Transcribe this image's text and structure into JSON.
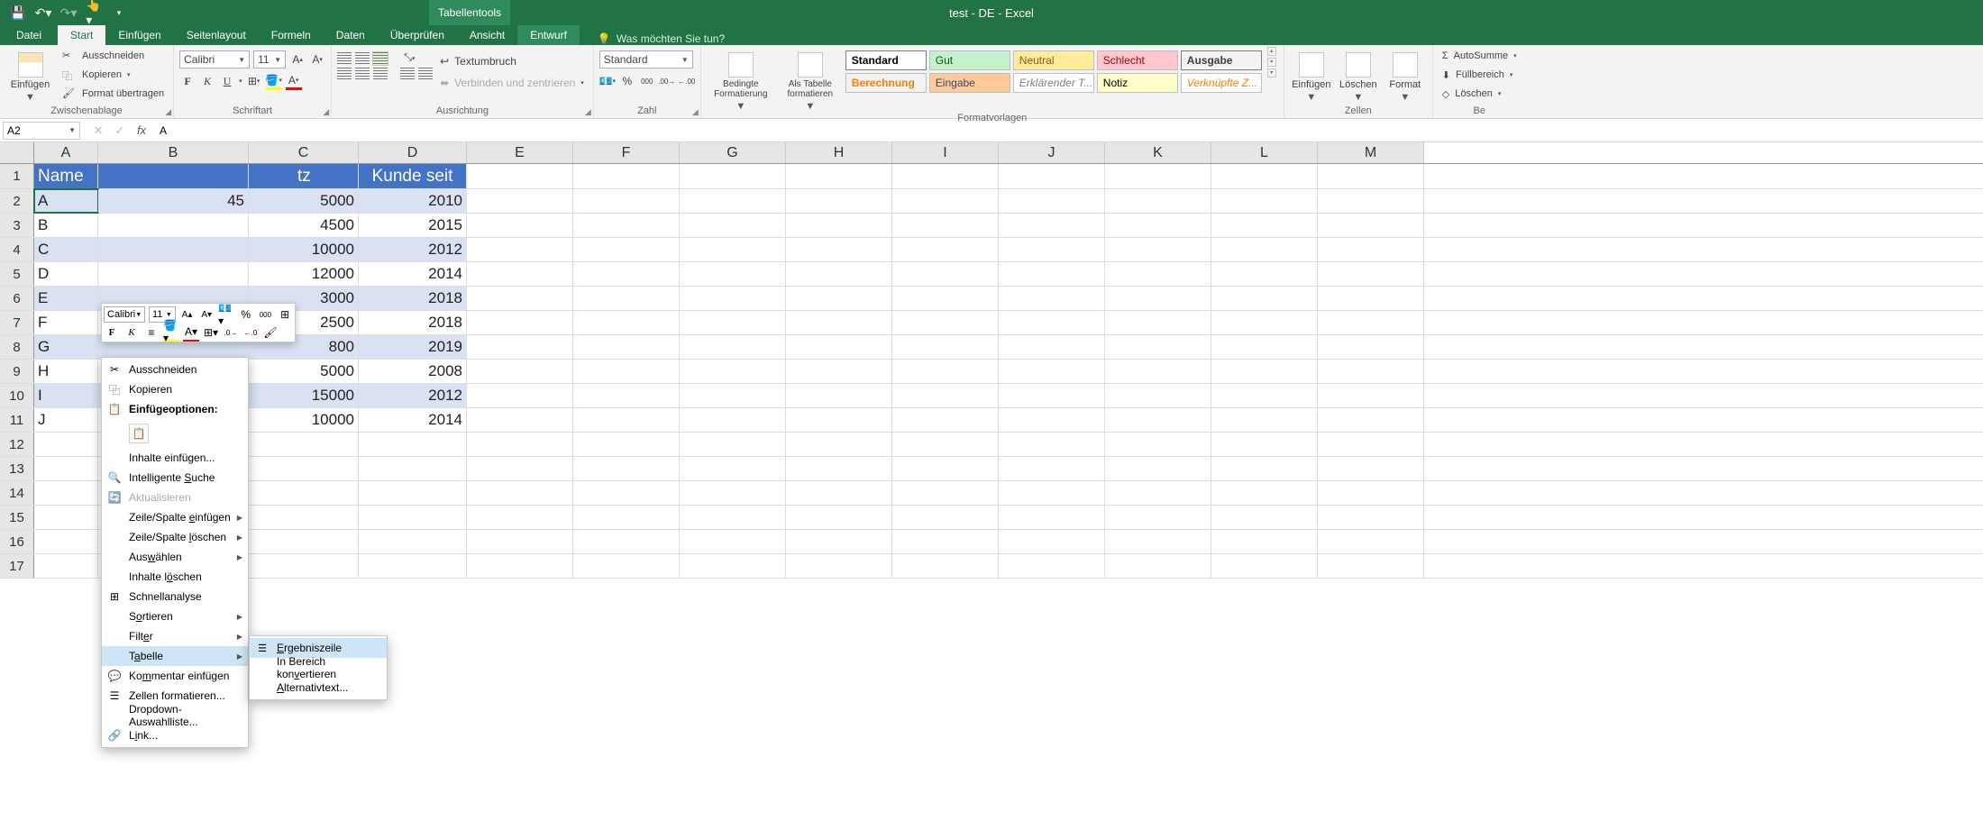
{
  "title": "test - DE - Excel",
  "tools_tab": "Tabellentools",
  "tabs": {
    "file": "Datei",
    "start": "Start",
    "insert": "Einfügen",
    "layout": "Seitenlayout",
    "formulas": "Formeln",
    "data": "Daten",
    "review": "Überprüfen",
    "view": "Ansicht",
    "design": "Entwurf",
    "tellme": "Was möchten Sie tun?"
  },
  "ribbon": {
    "clipboard": {
      "paste": "Einfügen",
      "cut": "Ausschneiden",
      "copy": "Kopieren",
      "painter": "Format übertragen",
      "label": "Zwischenablage"
    },
    "font": {
      "name": "Calibri",
      "size": "11",
      "bold": "F",
      "italic": "K",
      "underline": "U",
      "label": "Schriftart"
    },
    "align": {
      "wrap": "Textumbruch",
      "merge": "Verbinden und zentrieren",
      "label": "Ausrichtung"
    },
    "number": {
      "format": "Standard",
      "label": "Zahl"
    },
    "styles": {
      "condfmt": "Bedingte Formatierung",
      "astable": "Als Tabelle formatieren",
      "cells": [
        "Standard",
        "Gut",
        "Neutral",
        "Schlecht",
        "Ausgabe",
        "Berechnung",
        "Eingabe",
        "Erklärender T...",
        "Notiz",
        "Verknüpfte Z..."
      ],
      "label": "Formatvorlagen"
    },
    "cells2": {
      "insert": "Einfügen",
      "delete": "Löschen",
      "format": "Format",
      "label": "Zellen"
    },
    "editing": {
      "sum": "AutoSumme",
      "fill": "Füllbereich",
      "clear": "Löschen",
      "label": "Be"
    }
  },
  "namebox": "A2",
  "formula": "A",
  "columns": [
    "A",
    "B",
    "C",
    "D",
    "E",
    "F",
    "G",
    "H",
    "I",
    "J",
    "K",
    "L",
    "M"
  ],
  "headers": {
    "A": "Name",
    "D": "Kunde seit",
    "C_tail": "tz"
  },
  "rows": [
    {
      "n": 1
    },
    {
      "n": 2,
      "A": "A",
      "B": "45",
      "C": "5000",
      "D": "2010"
    },
    {
      "n": 3,
      "A": "B",
      "C": "4500",
      "D": "2015"
    },
    {
      "n": 4,
      "A": "C",
      "C": "10000",
      "D": "2012"
    },
    {
      "n": 5,
      "A": "D",
      "C": "12000",
      "D": "2014"
    },
    {
      "n": 6,
      "A": "E",
      "C": "3000",
      "D": "2018"
    },
    {
      "n": 7,
      "A": "F",
      "C": "2500",
      "D": "2018"
    },
    {
      "n": 8,
      "A": "G",
      "C": "800",
      "D": "2019"
    },
    {
      "n": 9,
      "A": "H",
      "C": "5000",
      "D": "2008"
    },
    {
      "n": 10,
      "A": "I",
      "C": "15000",
      "D": "2012"
    },
    {
      "n": 11,
      "A": "J",
      "C": "10000",
      "D": "2014"
    },
    {
      "n": 12
    },
    {
      "n": 13
    },
    {
      "n": 14
    },
    {
      "n": 15
    },
    {
      "n": 16
    },
    {
      "n": 17
    }
  ],
  "mini_toolbar": {
    "font": "Calibri",
    "size": "11",
    "bold": "F",
    "italic": "K",
    "percent": "%",
    "thousand": "000"
  },
  "ctx": {
    "cut": "Ausschneiden",
    "copy": "Kopieren",
    "paste_opts": "Einfügeoptionen:",
    "paste_special": "Inhalte einfügen...",
    "smart_lookup": "Intelligente Suche",
    "refresh": "Aktualisieren",
    "insert_rc": "Zeile/Spalte einfügen",
    "delete_rc": "Zeile/Spalte löschen",
    "select": "Auswählen",
    "clear": "Inhalte löschen",
    "quick": "Schnellanalyse",
    "sort": "Sortieren",
    "filter": "Filter",
    "table": "Tabelle",
    "comment": "Kommentar einfügen",
    "format_cells": "Zellen formatieren...",
    "dropdown": "Dropdown-Auswahlliste...",
    "link": "Link..."
  },
  "submenu": {
    "totals": "Ergebniszeile",
    "convert": "In Bereich konvertieren",
    "alttext": "Alternativtext..."
  },
  "style_colors": {
    "Standard": {
      "bg": "#ffffff",
      "fg": "#000000",
      "border": "#7f7f7f",
      "bold": true
    },
    "Gut": {
      "bg": "#c6efce",
      "fg": "#006100"
    },
    "Neutral": {
      "bg": "#ffeb9c",
      "fg": "#9c5700"
    },
    "Schlecht": {
      "bg": "#ffc7ce",
      "fg": "#9c0006"
    },
    "Ausgabe": {
      "bg": "#f2f2f2",
      "fg": "#3f3f3f",
      "border": "#7f7f7f",
      "bold": true
    },
    "Berechnung": {
      "bg": "#f2f2f2",
      "fg": "#fa7d00",
      "bold": true
    },
    "Eingabe": {
      "bg": "#ffcc99",
      "fg": "#3f3f76"
    },
    "Erklärender T...": {
      "bg": "#ffffff",
      "fg": "#7f7f7f",
      "italic": true
    },
    "Notiz": {
      "bg": "#ffffcc",
      "fg": "#000000"
    },
    "Verknüpfte Z...": {
      "bg": "#ffffff",
      "fg": "#fa7d00",
      "italic": true
    }
  }
}
